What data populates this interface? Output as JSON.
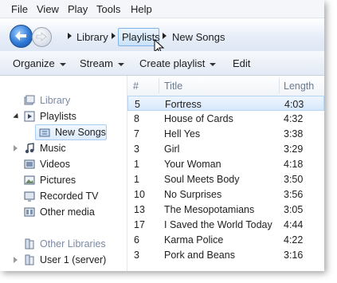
{
  "menu": [
    "File",
    "View",
    "Play",
    "Tools",
    "Help"
  ],
  "breadcrumbs": [
    "Library",
    "Playlists",
    "New Songs"
  ],
  "toolbar": {
    "organize": "Organize",
    "stream": "Stream",
    "create_playlist": "Create playlist",
    "edit": "Edit"
  },
  "nav": {
    "library": "Library",
    "playlists": "Playlists",
    "new_songs": "New Songs",
    "music": "Music",
    "videos": "Videos",
    "pictures": "Pictures",
    "recorded_tv": "Recorded TV",
    "other_media": "Other media",
    "other_libraries": "Other Libraries",
    "user1": "User 1 (server)"
  },
  "columns": {
    "num": "#",
    "title": "Title",
    "length": "Length"
  },
  "tracks": [
    {
      "num": "5",
      "title": "Fortress",
      "length": "4:03"
    },
    {
      "num": "8",
      "title": "House of Cards",
      "length": "4:32"
    },
    {
      "num": "7",
      "title": "Hell Yes",
      "length": "3:38"
    },
    {
      "num": "3",
      "title": "Girl",
      "length": "3:29"
    },
    {
      "num": "1",
      "title": "Your Woman",
      "length": "4:18"
    },
    {
      "num": "1",
      "title": "Soul Meets Body",
      "length": "3:50"
    },
    {
      "num": "10",
      "title": "No Surprises",
      "length": "3:56"
    },
    {
      "num": "13",
      "title": "The Mesopotamians",
      "length": "3:05"
    },
    {
      "num": "17",
      "title": "I Saved the World Today",
      "length": "4:44"
    },
    {
      "num": "6",
      "title": "Karma Police",
      "length": "4:22"
    },
    {
      "num": "3",
      "title": "Pork and Beans",
      "length": "3:16"
    }
  ],
  "colors": {
    "selection": "#d7e8fb",
    "selection_border": "#a9cdf2",
    "nav_blue": "#2f79d6"
  }
}
